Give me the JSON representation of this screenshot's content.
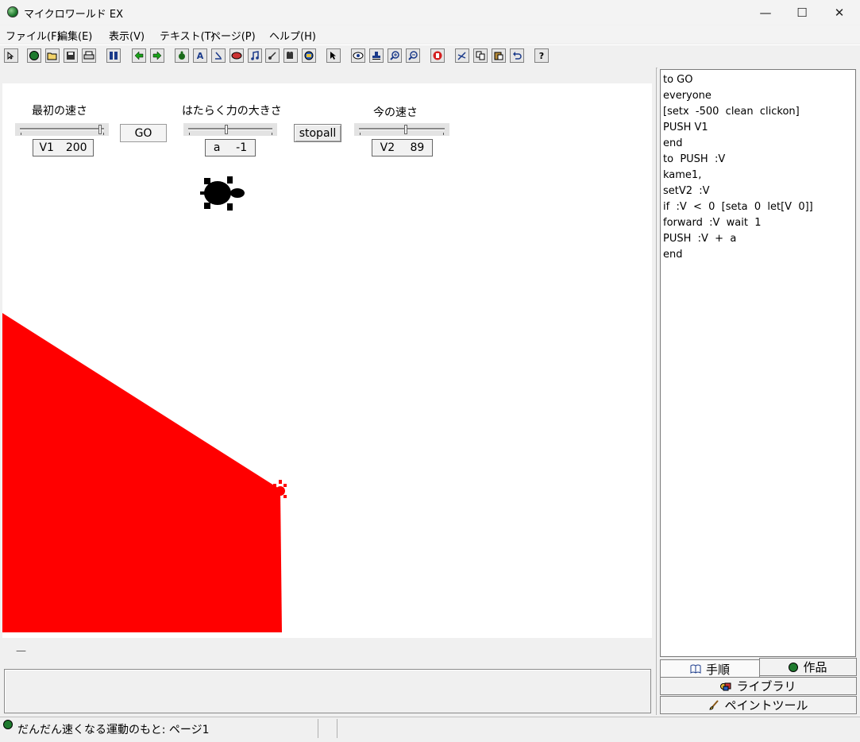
{
  "window": {
    "title": "マイクロワールド EX",
    "controls": {
      "minimize": "—",
      "maximize": "☐",
      "close": "✕"
    }
  },
  "menu": {
    "items": [
      "ファイル(F)",
      "編集(E)",
      "表示(V)",
      "テキスト(T)",
      "ページ(P)",
      "ヘルプ(H)"
    ]
  },
  "toolbar": {
    "icons": [
      "pointer-arrow-icon",
      "globe-icon",
      "open-folder-icon",
      "save-icon",
      "print-icon",
      "page-icon",
      "back-arrow-icon",
      "forward-arrow-icon",
      "turtle-hatch-icon",
      "text-box-icon",
      "slider-tool-icon",
      "button-tool-icon",
      "music-icon",
      "melody-icon",
      "video-icon",
      "shape-icon",
      "select-arrow-icon",
      "eye-icon",
      "stamp-icon",
      "zoom-in-icon",
      "zoom-out-icon",
      "stop-icon",
      "scissors-icon",
      "copy-icon",
      "paste-icon",
      "undo-icon",
      "help-icon"
    ],
    "help_label": "?",
    "text_icon_label": "A"
  },
  "stage": {
    "slider1": {
      "title": "最初の速さ",
      "var": "V1",
      "value": "200",
      "level": 0.95
    },
    "go_button": "GO",
    "slider2": {
      "title": "はたらく力の大きさ",
      "var": "a",
      "value": "-1",
      "level": 0.45
    },
    "stopall_button": "stopall",
    "slider3": {
      "title": "今の速さ",
      "var": "V2",
      "value": "89",
      "level": 0.55
    },
    "fill_color": "#ff0000",
    "turtle_color": "#000000"
  },
  "message": {
    "indicator": "—"
  },
  "procedures": {
    "lines": [
      "to GO",
      "everyone",
      "[setx  -500  clean  clickon]",
      "PUSH V1",
      "end",
      "to  PUSH  :V",
      "kame1,",
      "setV2  :V",
      "if  :V  <  0  [seta  0  let[V  0]]",
      "forward  :V  wait  1",
      "PUSH  :V  +  a",
      "end"
    ]
  },
  "panel_tabs": {
    "procedures": "手順",
    "project": "作品",
    "library": "ライブラリ",
    "paint": "ペイントツール"
  },
  "status": {
    "text": "だんだん速くなる運動のもと: ページ1"
  }
}
